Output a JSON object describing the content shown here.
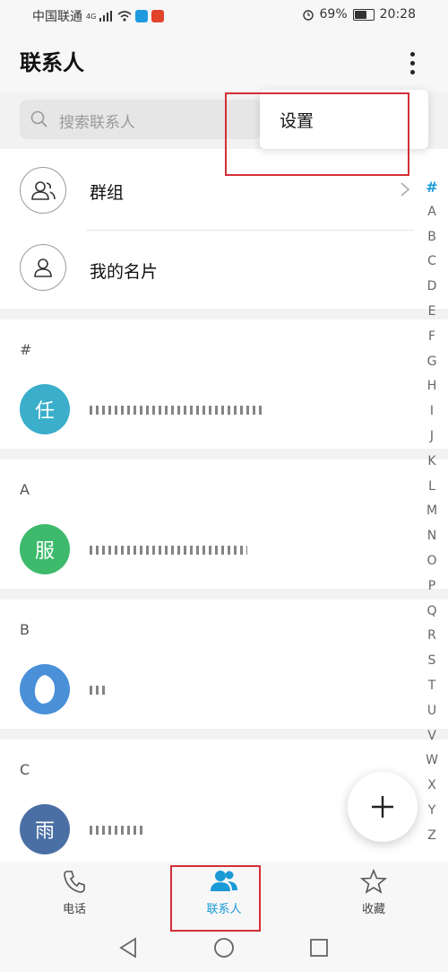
{
  "status_bar": {
    "carrier": "中国联通",
    "network": "4G",
    "battery": "69%",
    "time": "20:28"
  },
  "header": {
    "title": "联系人"
  },
  "search": {
    "placeholder": "搜索联系人"
  },
  "popup_menu": {
    "items": [
      {
        "label": "设置"
      }
    ]
  },
  "fixed_rows": [
    {
      "label": "群组",
      "icon": "group-icon"
    },
    {
      "label": "我的名片",
      "icon": "person-icon"
    }
  ],
  "sections": [
    {
      "letter": "#",
      "contact": {
        "avatar_text": "任",
        "avatar_color": "#3aaecb"
      }
    },
    {
      "letter": "A",
      "contact": {
        "avatar_text": "服",
        "avatar_color": "#3dba6b"
      }
    },
    {
      "letter": "B",
      "contact": {
        "avatar_text": "",
        "avatar_color": "#4a90d9"
      }
    },
    {
      "letter": "C",
      "contact": {
        "avatar_text": "雨",
        "avatar_color": "#4a6fa5"
      }
    }
  ],
  "alphabet_index": [
    "#",
    "A",
    "B",
    "C",
    "D",
    "E",
    "F",
    "G",
    "H",
    "I",
    "J",
    "K",
    "L",
    "M",
    "N",
    "O",
    "P",
    "Q",
    "R",
    "S",
    "T",
    "U",
    "V",
    "W",
    "X",
    "Y",
    "Z"
  ],
  "bottom_tabs": [
    {
      "label": "电话",
      "icon": "phone-icon"
    },
    {
      "label": "联系人",
      "icon": "contacts-icon",
      "active": true
    },
    {
      "label": "收藏",
      "icon": "star-icon"
    }
  ],
  "colors": {
    "accent": "#1a9ad6",
    "highlight_box": "#d32f35"
  }
}
